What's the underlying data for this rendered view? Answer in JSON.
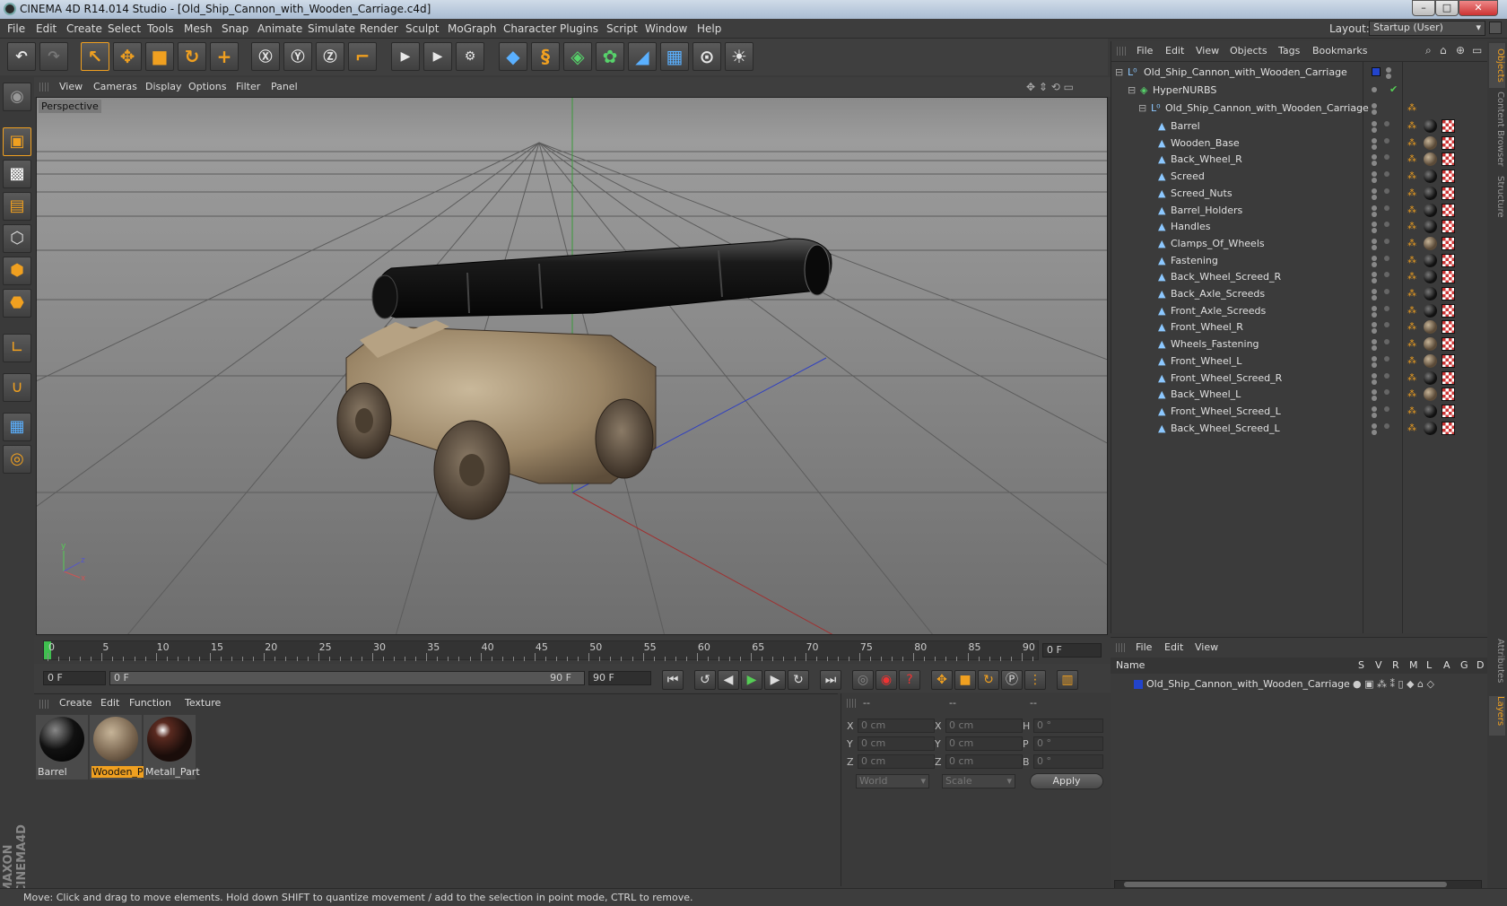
{
  "window": {
    "title": "CINEMA 4D R14.014 Studio - [Old_Ship_Cannon_with_Wooden_Carriage.c4d]"
  },
  "menu": [
    "File",
    "Edit",
    "Create",
    "Select",
    "Tools",
    "Mesh",
    "Snap",
    "Animate",
    "Simulate",
    "Render",
    "Sculpt",
    "MoGraph",
    "Character",
    "Plugins",
    "Script",
    "Window",
    "Help"
  ],
  "layout": {
    "label": "Layout:",
    "value": "Startup (User)"
  },
  "viewport": {
    "menu": [
      "View",
      "Cameras",
      "Display",
      "Options",
      "Filter",
      "Panel"
    ],
    "label": "Perspective"
  },
  "timeline": {
    "ticks": [
      "0",
      "5",
      "10",
      "15",
      "20",
      "25",
      "30",
      "35",
      "40",
      "45",
      "50",
      "55",
      "60",
      "65",
      "70",
      "75",
      "80",
      "85",
      "90"
    ],
    "current_frame": "0 F"
  },
  "transport": {
    "start": "0 F",
    "range_start": "0 F",
    "range_end": "90 F",
    "end": "90 F"
  },
  "materials": {
    "menu": [
      "Create",
      "Edit",
      "Function",
      "Texture"
    ],
    "items": [
      {
        "name": "Barrel"
      },
      {
        "name": "Wooden_P"
      },
      {
        "name": "Metall_Part"
      }
    ]
  },
  "coords": {
    "header": [
      "--",
      "--",
      "--"
    ],
    "rows": [
      {
        "a": "X",
        "av": "0 cm",
        "b": "X",
        "bv": "0 cm",
        "c": "H",
        "cv": "0 °"
      },
      {
        "a": "Y",
        "av": "0 cm",
        "b": "Y",
        "bv": "0 cm",
        "c": "P",
        "cv": "0 °"
      },
      {
        "a": "Z",
        "av": "0 cm",
        "b": "Z",
        "bv": "0 cm",
        "c": "B",
        "cv": "0 °"
      }
    ],
    "space": "World",
    "mode": "Scale",
    "apply": "Apply"
  },
  "objects": {
    "menu": [
      "File",
      "Edit",
      "View",
      "Objects",
      "Tags",
      "Bookmarks"
    ],
    "root": "Old_Ship_Cannon_with_Wooden_Carriage",
    "hypernurbs": "HyperNURBS",
    "group": "Old_Ship_Cannon_with_Wooden_Carriage",
    "children": [
      "Barrel",
      "Wooden_Base",
      "Back_Wheel_R",
      "Screed",
      "Screed_Nuts",
      "Barrel_Holders",
      "Handles",
      "Clamps_Of_Wheels",
      "Fastening",
      "Back_Wheel_Screed_R",
      "Back_Axle_Screeds",
      "Front_Axle_Screeds",
      "Front_Wheel_R",
      "Wheels_Fastening",
      "Front_Wheel_L",
      "Front_Wheel_Screed_R",
      "Back_Wheel_L",
      "Front_Wheel_Screed_L",
      "Back_Wheel_Screed_L"
    ]
  },
  "layers": {
    "menu": [
      "File",
      "Edit",
      "View"
    ],
    "columns": [
      "Name",
      "S",
      "V",
      "R",
      "M",
      "L",
      "A",
      "G",
      "D"
    ],
    "row": "Old_Ship_Cannon_with_Wooden_Carriage"
  },
  "side_tabs": [
    "Objects",
    "Content Browser",
    "Structure",
    "Attributes",
    "Layers"
  ],
  "status": "Move: Click and drag to move elements. Hold down SHIFT to quantize movement / add to the selection in point mode, CTRL to remove.",
  "colors": {
    "accent": "#f0a020",
    "blue": "#5ab0ff",
    "bg": "#3a3a3a"
  }
}
